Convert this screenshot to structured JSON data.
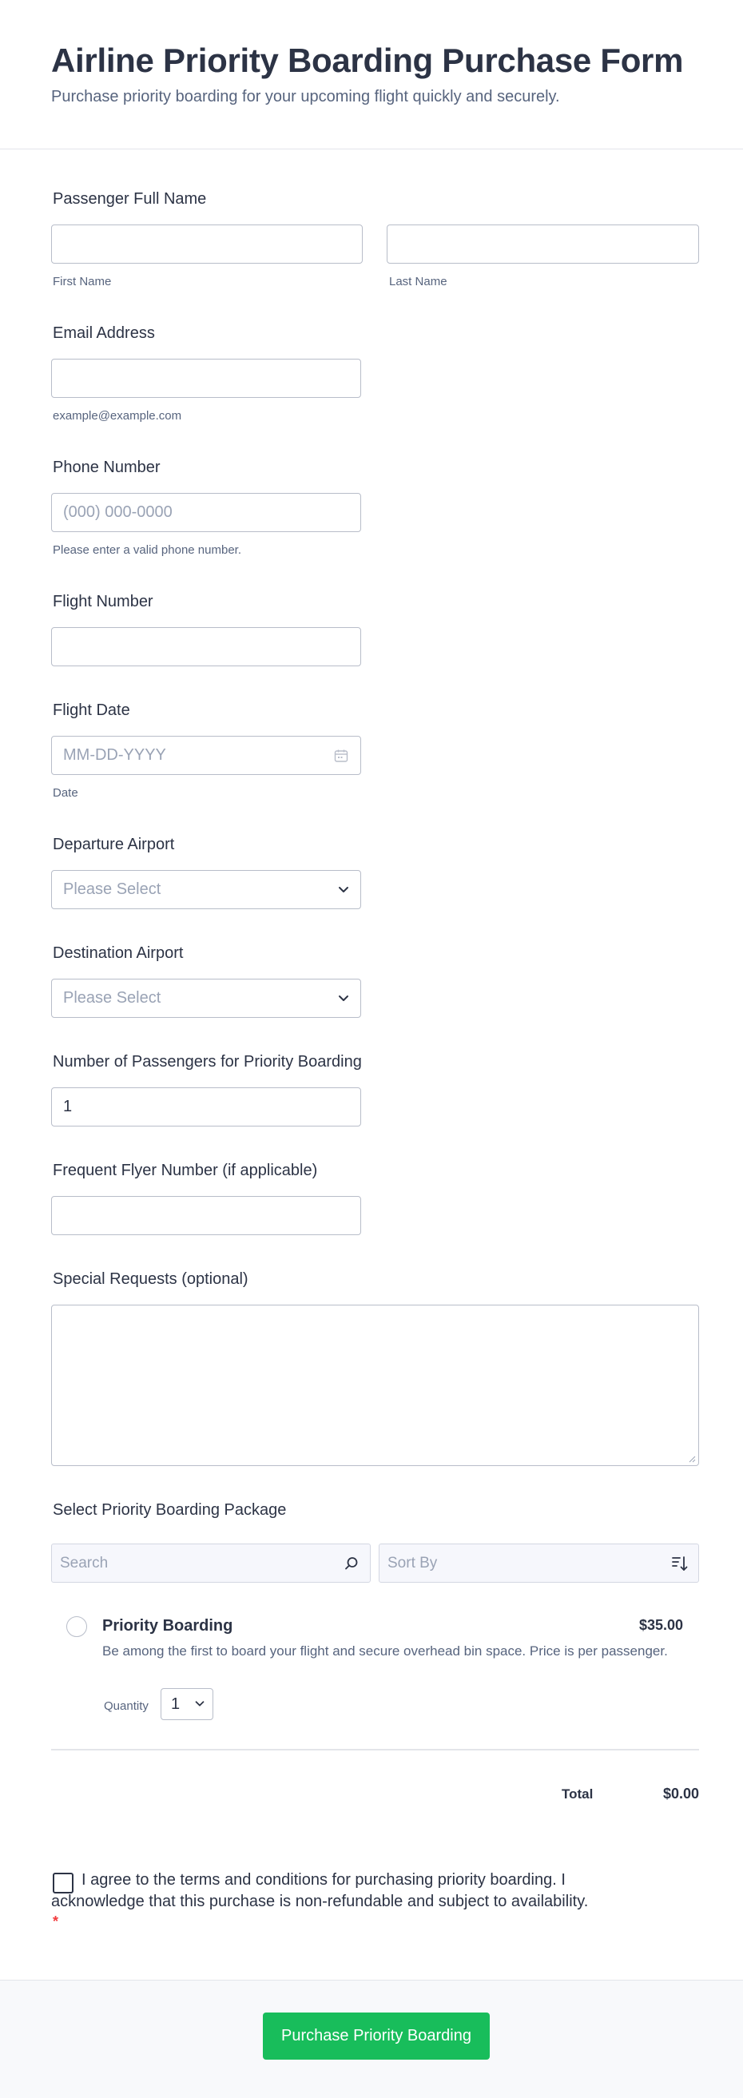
{
  "form": {
    "title": "Airline Priority Boarding Purchase Form",
    "subtitle": "Purchase priority boarding for your upcoming flight quickly and securely."
  },
  "full_name": {
    "label": "Passenger Full Name",
    "first_sublabel": "First Name",
    "last_sublabel": "Last Name"
  },
  "email": {
    "label": "Email Address",
    "sublabel": "example@example.com"
  },
  "phone": {
    "label": "Phone Number",
    "placeholder": "(000) 000-0000",
    "sublabel": "Please enter a valid phone number."
  },
  "flight_number": {
    "label": "Flight Number"
  },
  "flight_date": {
    "label": "Flight Date",
    "placeholder": "MM-DD-YYYY",
    "sublabel": "Date"
  },
  "departure": {
    "label": "Departure Airport",
    "placeholder": "Please Select"
  },
  "destination": {
    "label": "Destination Airport",
    "placeholder": "Please Select"
  },
  "passengers": {
    "label": "Number of Passengers for Priority Boarding",
    "value": "1"
  },
  "frequent_flyer": {
    "label": "Frequent Flyer Number (if applicable)"
  },
  "special_requests": {
    "label": "Special Requests (optional)"
  },
  "package": {
    "label": "Select Priority Boarding Package",
    "search_placeholder": "Search",
    "sort_placeholder": "Sort By",
    "product": {
      "name": "Priority Boarding",
      "price": "$35.00",
      "description": "Be among the first to board your flight and secure overhead bin space. Price is per passenger.",
      "quantity_label": "Quantity",
      "quantity_value": "1"
    },
    "total_label": "Total",
    "total_value": "$0.00"
  },
  "terms": {
    "text": "I agree to the terms and conditions for purchasing priority boarding. I acknowledge that this purchase is non-refundable and subject to availability.",
    "required_mark": "*"
  },
  "submit": {
    "label": "Purchase Priority Boarding"
  },
  "colors": {
    "submit_bg": "#18bd5b",
    "text": "#2c3345",
    "muted": "#57647e",
    "required": "#f23a3c"
  },
  "icons": [
    "chevron-down-icon",
    "calendar-icon",
    "search-icon",
    "sort-icon",
    "resize-grip-icon"
  ]
}
